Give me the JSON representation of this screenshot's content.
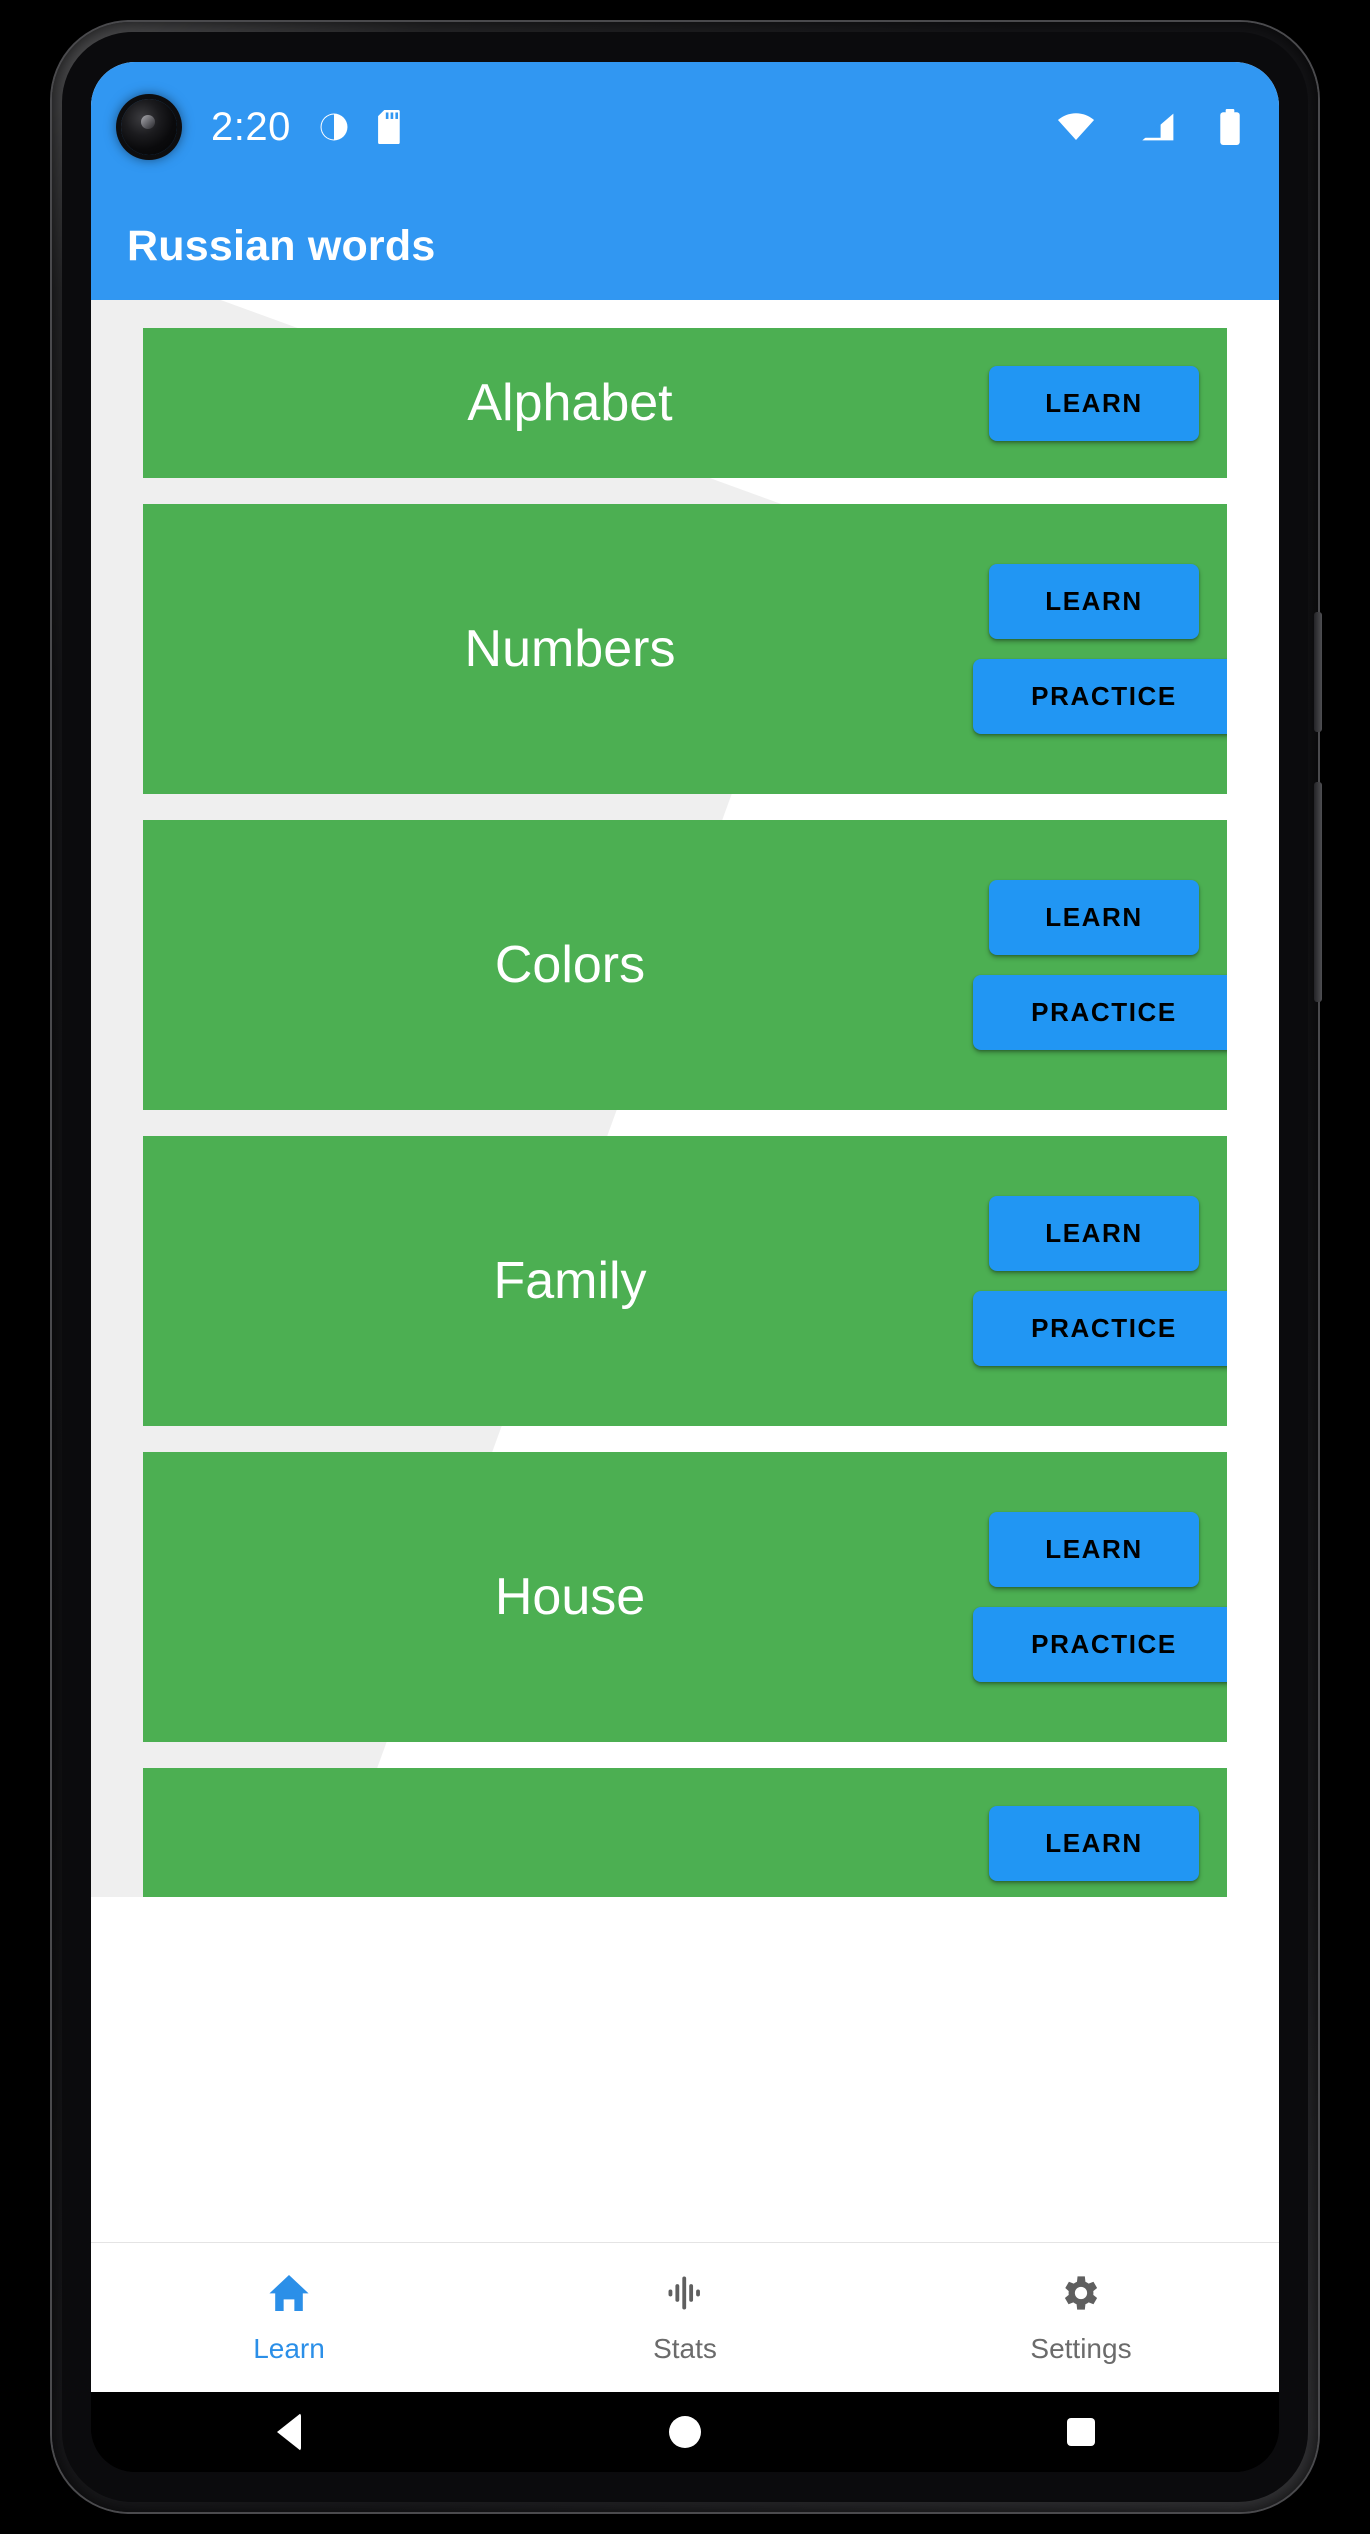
{
  "status_bar": {
    "time": "2:20",
    "left_icons": [
      "do-not-disturb-icon",
      "sd-card-icon"
    ],
    "right_icons": [
      "wifi-icon",
      "cellular-signal-icon",
      "battery-icon"
    ],
    "background_color": "#3197f2"
  },
  "app_bar": {
    "title": "Russian words",
    "background_color": "#3197f2",
    "title_color": "#ffffff"
  },
  "theme": {
    "card_green": "#4caf52",
    "button_blue": "#2196f3",
    "button_text": "#000000",
    "accent_blue": "#2b8fe8",
    "content_background": "#ffffff"
  },
  "main": {
    "cards": [
      {
        "title": "Alphabet",
        "buttons": [
          "LEARN"
        ]
      },
      {
        "title": "Numbers",
        "buttons": [
          "LEARN",
          "PRACTICE"
        ]
      },
      {
        "title": "Colors",
        "buttons": [
          "LEARN",
          "PRACTICE"
        ]
      },
      {
        "title": "Family",
        "buttons": [
          "LEARN",
          "PRACTICE"
        ]
      },
      {
        "title": "House",
        "buttons": [
          "LEARN",
          "PRACTICE"
        ]
      },
      {
        "title": "",
        "buttons": [
          "LEARN"
        ]
      }
    ]
  },
  "bottom_nav": {
    "items": [
      {
        "label": "Learn",
        "icon": "home-icon",
        "active": true
      },
      {
        "label": "Stats",
        "icon": "equalizer-icon",
        "active": false
      },
      {
        "label": "Settings",
        "icon": "gear-icon",
        "active": false
      }
    ]
  },
  "system_nav": {
    "back": "back-icon",
    "home": "home-circle-icon",
    "recents": "recents-square-icon"
  }
}
